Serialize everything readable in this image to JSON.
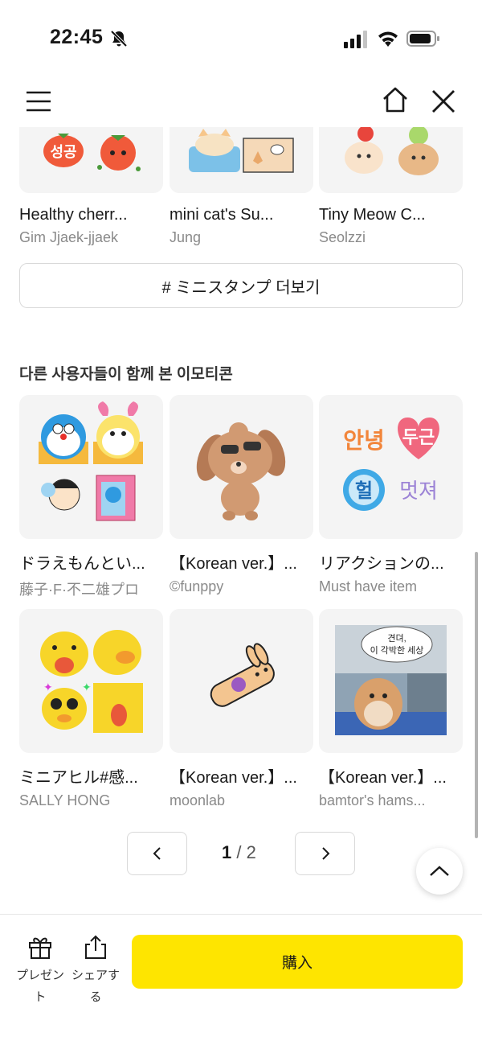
{
  "status_bar": {
    "time": "22:45"
  },
  "partial_row": [
    {
      "title": "Healthy cherr...",
      "author": "Gim Jjaek-jjaek",
      "sticker_text": "성공"
    },
    {
      "title": "mini cat's Su...",
      "author": "Jung"
    },
    {
      "title": "Tiny Meow C...",
      "author": "Seolzzi"
    }
  ],
  "more_button": {
    "label": "# ミニスタンプ 더보기"
  },
  "section": {
    "title": "다른 사용자들이 함께 본 이모티콘"
  },
  "grid": [
    {
      "title": "ドラえもんとい...",
      "author": "藤子·F·不二雄プロ"
    },
    {
      "title": "【Korean ver.】...",
      "author": "©funppy"
    },
    {
      "title": "リアクションの...",
      "author": "Must have item",
      "sticker_words": [
        "안녕",
        "두근",
        "헐",
        "멋져"
      ]
    },
    {
      "title": "ミニアヒル#感...",
      "author": "SALLY HONG"
    },
    {
      "title": "【Korean ver.】...",
      "author": "moonlab"
    },
    {
      "title": "【Korean ver.】...",
      "author": "bamtor's hams...",
      "bubble_line1": "견뎌,",
      "bubble_line2": "이 각박한 세상"
    }
  ],
  "pagination": {
    "current": "1",
    "separator": "/",
    "total": "2"
  },
  "bottom_bar": {
    "present_label": "プレゼント",
    "share_label": "シェアする",
    "buy_label": "購入"
  },
  "colors": {
    "buy_button": "#fee500",
    "author_text": "#8a8a8a",
    "thumb_bg": "#f4f4f4"
  }
}
